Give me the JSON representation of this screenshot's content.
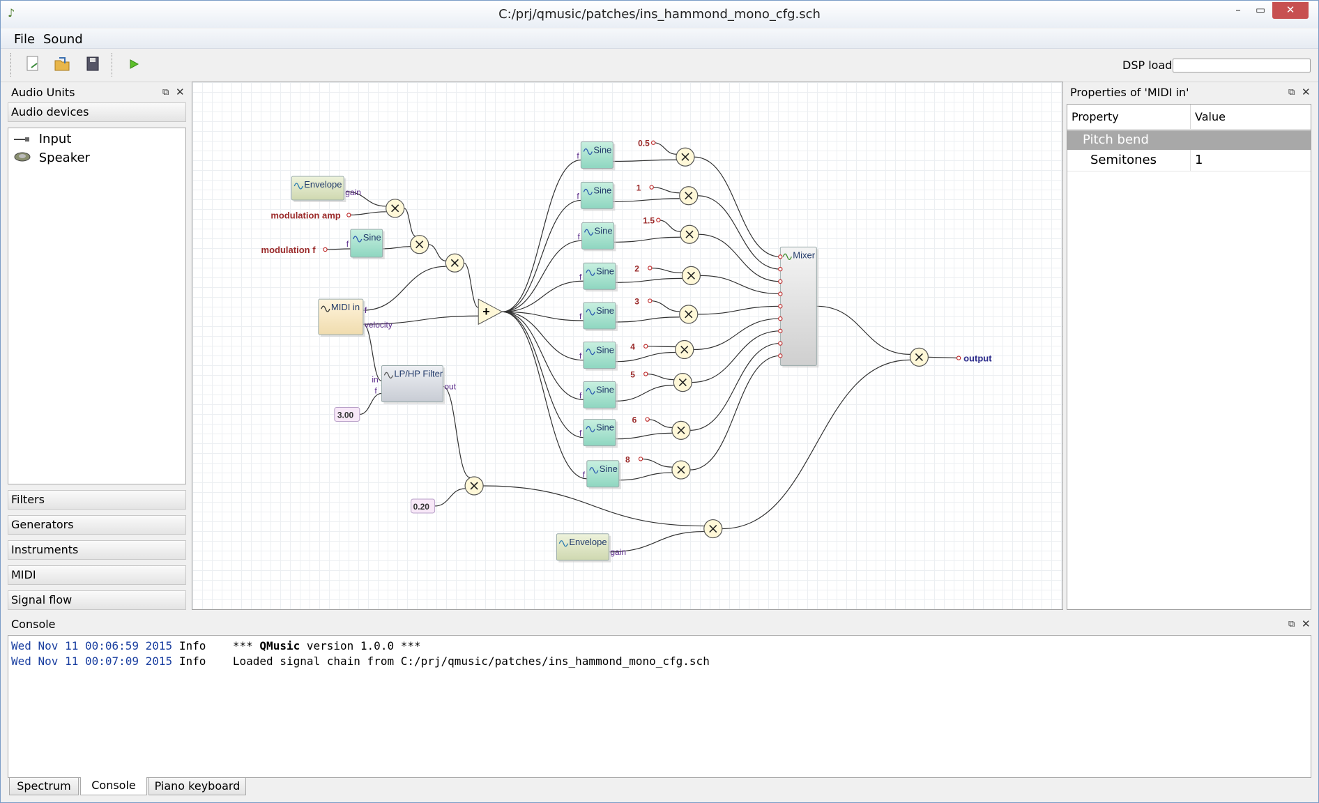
{
  "window": {
    "title": "C:/prj/qmusic/patches/ins_hammond_mono_cfg.sch"
  },
  "menu": {
    "file": "File",
    "sound": "Sound"
  },
  "toolbar": {
    "dsp_label": "DSP load"
  },
  "left_dock": {
    "title": "Audio Units",
    "devices_header": "Audio devices",
    "devices": [
      "Input",
      "Speaker"
    ],
    "sections": [
      "Filters",
      "Generators",
      "Instruments",
      "MIDI",
      "Signal flow"
    ]
  },
  "properties": {
    "title": "Properties of 'MIDI in'",
    "col_property": "Property",
    "col_value": "Value",
    "group": "Pitch bend",
    "row_name": "Semitones",
    "row_value": "1"
  },
  "console": {
    "title": "Console",
    "lines": [
      {
        "date": "Wed Nov 11 00:06:59 2015",
        "level": "Info",
        "pre": "*** ",
        "bold": "QMusic",
        "post": " version 1.0.0 ***"
      },
      {
        "date": "Wed Nov 11 00:07:09 2015",
        "level": "Info",
        "pre": "Loaded signal chain from C:/prj/qmusic/patches/ins_hammond_mono_cfg.sch",
        "bold": "",
        "post": ""
      }
    ]
  },
  "bottom_tabs": [
    "Spectrum",
    "Console",
    "Piano keyboard"
  ],
  "graph": {
    "labels": {
      "envelope": "Envelope",
      "gain": "gain",
      "mod_amp": "modulation amp",
      "mod_f": "modulation f",
      "sine": "Sine",
      "f": "f",
      "midi_in": "MIDI in",
      "velocity": "velocity",
      "lphp": "LP/HP Filter",
      "in": "in",
      "out": "out",
      "const_300": "3.00",
      "const_020": "0.20",
      "mixer": "Mixer",
      "output": "output"
    },
    "harmonics": [
      "0.5",
      "1",
      "1.5",
      "2",
      "3",
      "4",
      "5",
      "6",
      "8"
    ]
  }
}
